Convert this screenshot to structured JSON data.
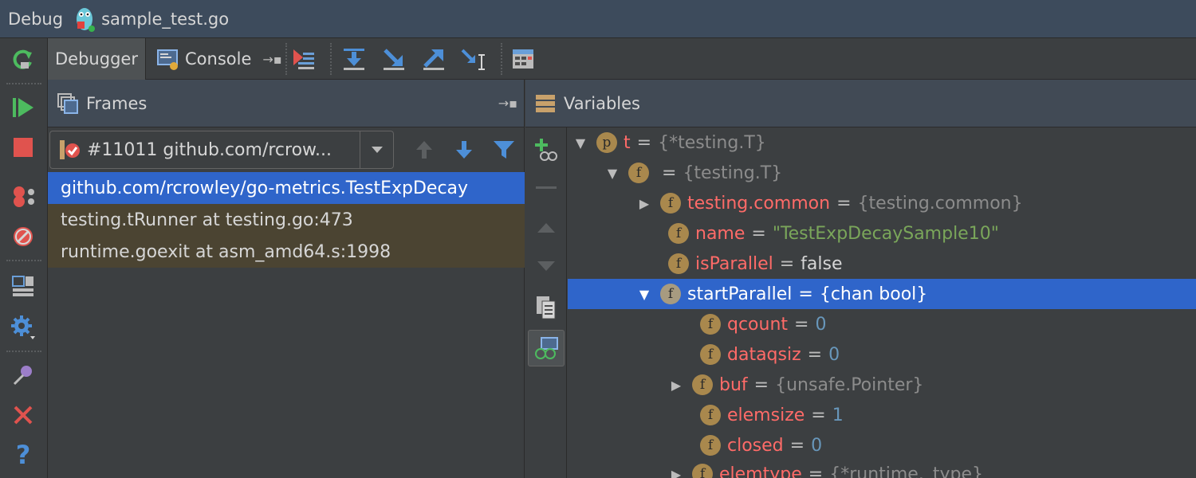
{
  "titlebar": {
    "label": "Debug",
    "file": "sample_test.go"
  },
  "tabs": {
    "debugger": "Debugger",
    "console": "Console"
  },
  "frames": {
    "title": "Frames",
    "thread": "#11011 github.com/rcrow...",
    "rows": [
      "github.com/rcrowley/go-metrics.TestExpDecay",
      "testing.tRunner at testing.go:473",
      "runtime.goexit at asm_amd64.s:1998"
    ]
  },
  "variables": {
    "title": "Variables",
    "rows": [
      {
        "badge": "p",
        "name": "t",
        "eq": "=",
        "value": "{*testing.T}"
      },
      {
        "badge": "f",
        "name": "",
        "eq": "=",
        "value": "{testing.T}"
      },
      {
        "badge": "f",
        "name": "testing.common",
        "eq": "=",
        "value": "{testing.common}"
      },
      {
        "badge": "f",
        "name": "name",
        "eq": "=",
        "value": "\"TestExpDecaySample10\""
      },
      {
        "badge": "f",
        "name": "isParallel",
        "eq": "=",
        "value": "false"
      },
      {
        "badge": "f",
        "name": "startParallel",
        "eq": "=",
        "value": "{chan bool}"
      },
      {
        "badge": "f",
        "name": "qcount",
        "eq": "=",
        "value": "0"
      },
      {
        "badge": "f",
        "name": "dataqsiz",
        "eq": "=",
        "value": "0"
      },
      {
        "badge": "f",
        "name": "buf",
        "eq": "=",
        "value": "{unsafe.Pointer}"
      },
      {
        "badge": "f",
        "name": "elemsize",
        "eq": "=",
        "value": "1"
      },
      {
        "badge": "f",
        "name": "closed",
        "eq": "=",
        "value": "0"
      },
      {
        "badge": "f",
        "name": "elemtype",
        "eq": "=",
        "value": "{*runtime._type}"
      }
    ]
  },
  "colors": {
    "selection": "#2f65ca",
    "frame_bg": "#4b4432",
    "badge": "#a9884d"
  }
}
